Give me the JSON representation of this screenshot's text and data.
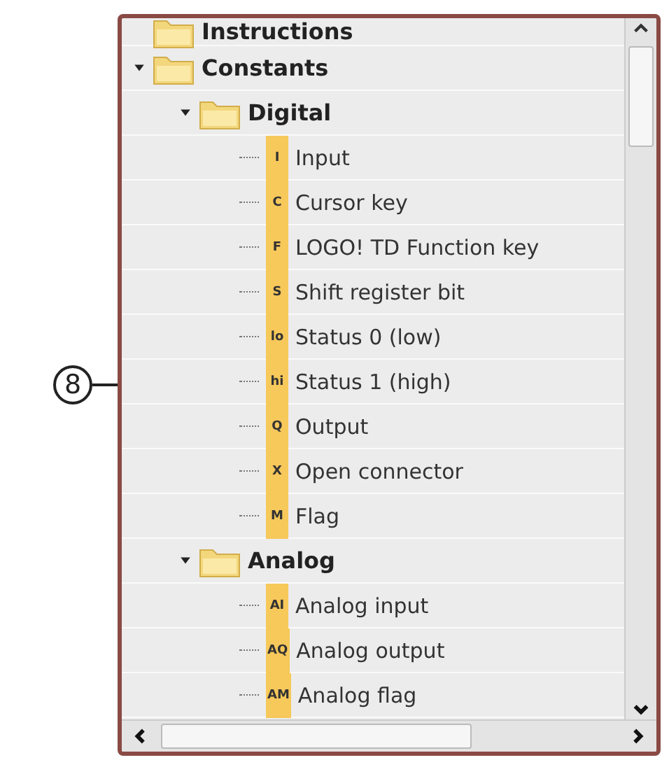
{
  "callout": "8",
  "tree": [
    {
      "kind": "folder",
      "label": "Instructions",
      "expanded": false
    },
    {
      "kind": "folder",
      "label": "Constants",
      "expanded": true,
      "children": [
        {
          "kind": "folder",
          "label": "Digital",
          "expanded": true,
          "children": [
            {
              "kind": "constant",
              "badge": "I",
              "label": "Input"
            },
            {
              "kind": "constant",
              "badge": "C",
              "label": "Cursor key"
            },
            {
              "kind": "constant",
              "badge": "F",
              "label": "LOGO! TD Function key"
            },
            {
              "kind": "constant",
              "badge": "S",
              "label": "Shift register bit"
            },
            {
              "kind": "constant",
              "badge": "lo",
              "label": "Status 0 (low)"
            },
            {
              "kind": "constant",
              "badge": "hi",
              "label": "Status 1 (high)"
            },
            {
              "kind": "constant",
              "badge": "Q",
              "label": "Output"
            },
            {
              "kind": "constant",
              "badge": "X",
              "label": "Open connector"
            },
            {
              "kind": "constant",
              "badge": "M",
              "label": "Flag"
            }
          ]
        },
        {
          "kind": "folder",
          "label": "Analog",
          "expanded": true,
          "children": [
            {
              "kind": "constant",
              "badge": "AI",
              "label": "Analog input"
            },
            {
              "kind": "constant",
              "badge": "AQ",
              "label": "Analog output"
            },
            {
              "kind": "constant",
              "badge": "AM",
              "label": "Analog flag"
            }
          ]
        }
      ]
    }
  ]
}
